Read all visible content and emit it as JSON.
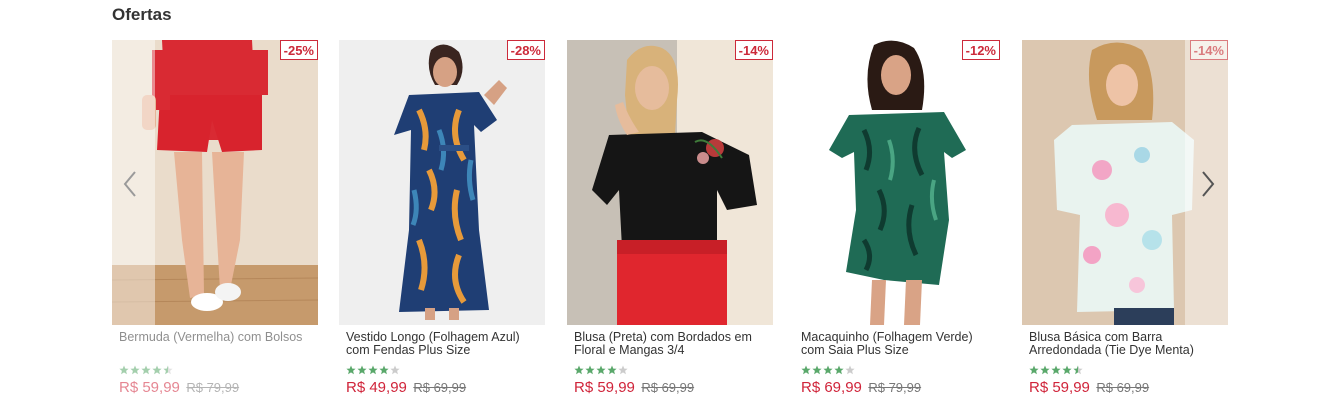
{
  "section": {
    "title": "Ofertas"
  },
  "colors": {
    "price": "#d0243a",
    "badge": "#cc2a3a",
    "star_filled": "#5aa86b",
    "star_empty": "#cccccc"
  },
  "navigation": {
    "prev_icon": "chevron-left-icon",
    "next_icon": "chevron-right-icon"
  },
  "products": [
    {
      "name": "Bermuda (Vermelha) com Bolsos",
      "discount": "-25%",
      "price": "R$ 59,99",
      "old_price": "R$ 79,99",
      "rating": 4.5,
      "image": "model wearing red shorts and white sneakers"
    },
    {
      "name": "Vestido Longo (Folhagem Azul) com Fendas Plus Size",
      "discount": "-28%",
      "price": "R$ 49,99",
      "old_price": "R$ 69,99",
      "rating": 4,
      "image": "model wearing long blue leaf-print dress"
    },
    {
      "name": "Blusa (Preta) com Bordados em Floral e Mangas 3/4",
      "discount": "-14%",
      "price": "R$ 59,99",
      "old_price": "R$ 69,99",
      "rating": 4,
      "image": "model wearing black blouse with floral embroidery"
    },
    {
      "name": "Macaquinho (Folhagem Verde) com Saia Plus Size",
      "discount": "-12%",
      "price": "R$ 69,99",
      "old_price": "R$ 79,99",
      "rating": 4,
      "image": "model wearing green leaf-print romper"
    },
    {
      "name": "Blusa Básica com Barra Arredondada (Tie Dye Menta)",
      "discount": "-14%",
      "price": "R$ 59,99",
      "old_price": "R$ 69,99",
      "rating": 4.5,
      "image": "model wearing tie dye mint blouse"
    }
  ]
}
